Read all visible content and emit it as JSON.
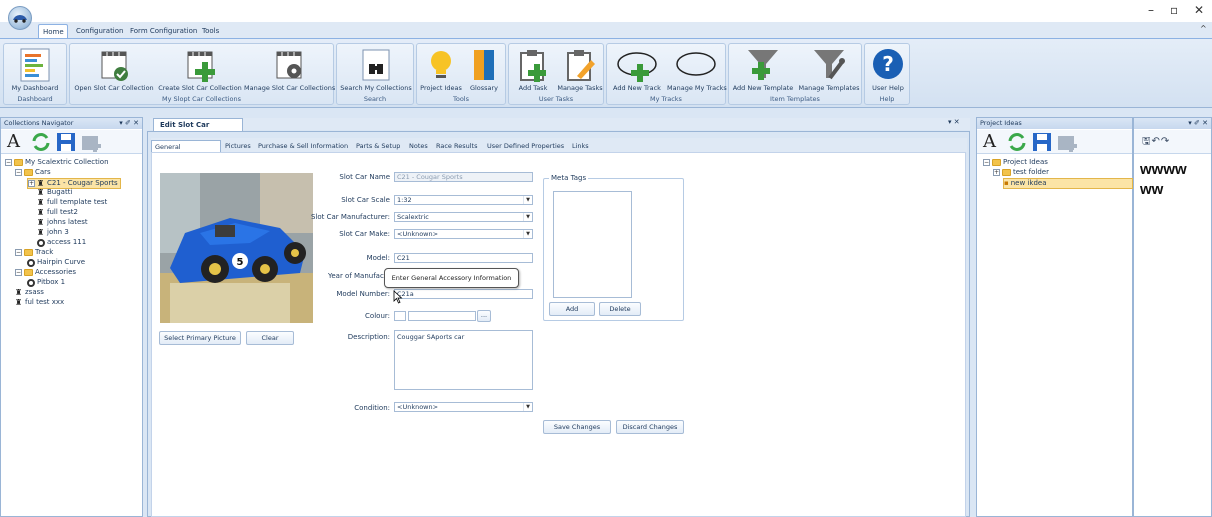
{
  "window": {
    "min": "–",
    "max": "▫",
    "close": "✕",
    "collapse": "^"
  },
  "ribbon_tabs": [
    "Home",
    "Configuration",
    "Form Configuration",
    "Tools"
  ],
  "ribbon": {
    "groups": [
      {
        "caption": "Dashboard",
        "buttons": [
          "My Dashboard"
        ]
      },
      {
        "caption": "My Slopt Car Collections",
        "buttons": [
          "Open Slot Car Collection",
          "Create Slot Car Collection",
          "Manage Slot Car Collections"
        ]
      },
      {
        "caption": "Search",
        "buttons": [
          "Search My Collections"
        ]
      },
      {
        "caption": "Tools",
        "buttons": [
          "Project Ideas",
          "Glossary"
        ]
      },
      {
        "caption": "User Tasks",
        "buttons": [
          "Add Task",
          "Manage Tasks"
        ]
      },
      {
        "caption": "My Tracks",
        "buttons": [
          "Add New Track",
          "Manage My Tracks"
        ]
      },
      {
        "caption": "Item Templates",
        "buttons": [
          "Add New Template",
          "Manage Templates"
        ]
      },
      {
        "caption": "Help",
        "buttons": [
          "User Help"
        ]
      }
    ]
  },
  "navigator": {
    "title": "Collections Navigator",
    "controls": "▾ ✐ ✕",
    "tree": [
      {
        "label": "My Scalextric Collection",
        "type": "folder",
        "exp": "⊟"
      },
      {
        "label": "Cars",
        "type": "folder",
        "exp": "⊟"
      },
      {
        "label": "C21 - Cougar Sports",
        "type": "car",
        "exp": "⊞"
      },
      {
        "label": "Bugatti",
        "type": "car"
      },
      {
        "label": "full template test",
        "type": "car"
      },
      {
        "label": "full test2",
        "type": "car"
      },
      {
        "label": "johns latest",
        "type": "car"
      },
      {
        "label": "john 3",
        "type": "car"
      },
      {
        "label": "access 111",
        "type": "track"
      },
      {
        "label": "Track",
        "type": "folder",
        "exp": "⊟"
      },
      {
        "label": "Hairpin Curve",
        "type": "track"
      },
      {
        "label": "Accessories",
        "type": "folder",
        "exp": "⊟"
      },
      {
        "label": "Pitbox 1",
        "type": "track"
      },
      {
        "label": "zsass",
        "type": "car"
      },
      {
        "label": "ful test xxx",
        "type": "car"
      }
    ]
  },
  "editor": {
    "tab": "Edit Slot Car Properties",
    "close": "▾ ✕",
    "subtabs": [
      "General Information",
      "Pictures",
      "Purchase & Sell Information",
      "Parts & Setup",
      "Notes",
      "Race Results",
      "User Defined Properties",
      "Links"
    ],
    "fields": {
      "name_label": "Slot Car Name",
      "name_value": "C21 - Cougar Sports",
      "scale_label": "Slot Car Scale",
      "scale_value": "1:32",
      "mfr_label": "Slot Car Manufacturer:",
      "mfr_value": "Scalextric",
      "make_label": "Slot Car Make:",
      "make_value": "<Unknown>",
      "model_label": "Model:",
      "model_value": "C21",
      "year_label": "Year of Manufactu",
      "modelnum_label": "Model Number:",
      "modelnum_value": "C21a",
      "colour_label": "Colour:",
      "colour_btn": "...",
      "desc_label": "Description:",
      "desc_value": "Couggar SAports car",
      "cond_label": "Condition:",
      "cond_value": "<Unknown>"
    },
    "meta_tags_title": "Meta Tags",
    "buttons": {
      "add": "Add",
      "delete": "Delete",
      "save": "Save Changes",
      "discard": "Discard Changes",
      "select_picture": "Select Primary Picture",
      "clear": "Clear"
    },
    "tooltip": "Enter General Accessory Information"
  },
  "project_ideas": {
    "title": "Project Ideas",
    "controls": "▾ ✐ ✕",
    "tree": [
      {
        "label": "Project Ideas",
        "type": "folder",
        "exp": "⊟"
      },
      {
        "label": "test folder",
        "type": "folder",
        "exp": "⊞"
      },
      {
        "label": "new ikdea",
        "type": "note"
      }
    ],
    "note_lines": [
      "wwww",
      "ww"
    ]
  }
}
